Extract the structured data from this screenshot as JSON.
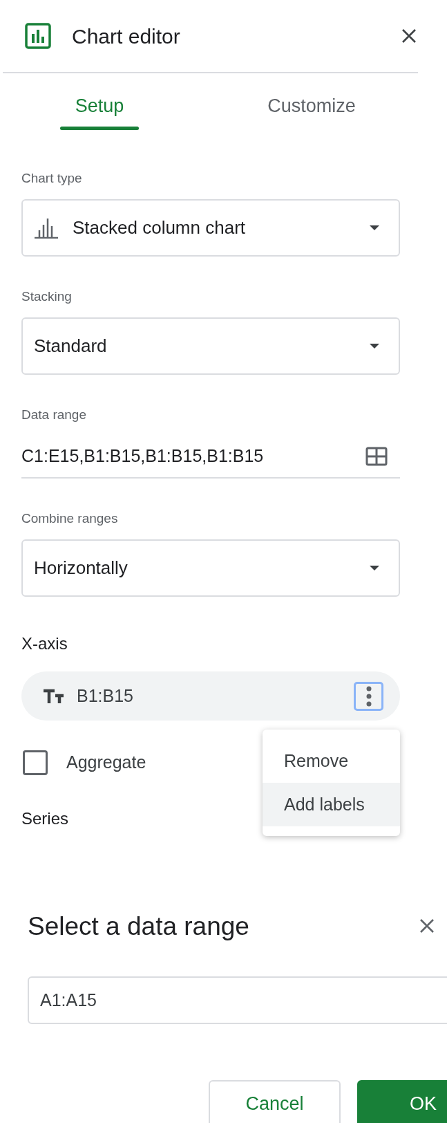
{
  "panel": {
    "title": "Chart editor"
  },
  "tabs": [
    {
      "label": "Setup",
      "selected": true
    },
    {
      "label": "Customize",
      "selected": false
    }
  ],
  "fields": [
    {
      "kind": "dropdown",
      "label": "Chart type",
      "value": "Stacked column chart",
      "has_icon": true
    },
    {
      "kind": "dropdown",
      "label": "Stacking",
      "value": "Standard",
      "has_icon": false
    },
    {
      "kind": "range",
      "label": "Data range",
      "value": "C1:E15,B1:B15,B1:B15,B1:B15"
    },
    {
      "kind": "dropdown",
      "label": "Combine ranges",
      "value": "Horizontally",
      "has_icon": false
    }
  ],
  "x_axis": {
    "heading": "X-axis",
    "range": "B1:B15",
    "menu_open": true,
    "menu": [
      {
        "label": "Remove",
        "highlighted": false
      },
      {
        "label": "Add labels",
        "highlighted": true
      }
    ]
  },
  "aggregate": {
    "label": "Aggregate",
    "checked": false
  },
  "series": {
    "heading": "Series"
  },
  "dialog": {
    "title": "Select a data range",
    "value": "A1:A15",
    "buttons": [
      {
        "kind": "secondary",
        "label": "Cancel"
      },
      {
        "kind": "primary",
        "label": "OK"
      }
    ]
  }
}
